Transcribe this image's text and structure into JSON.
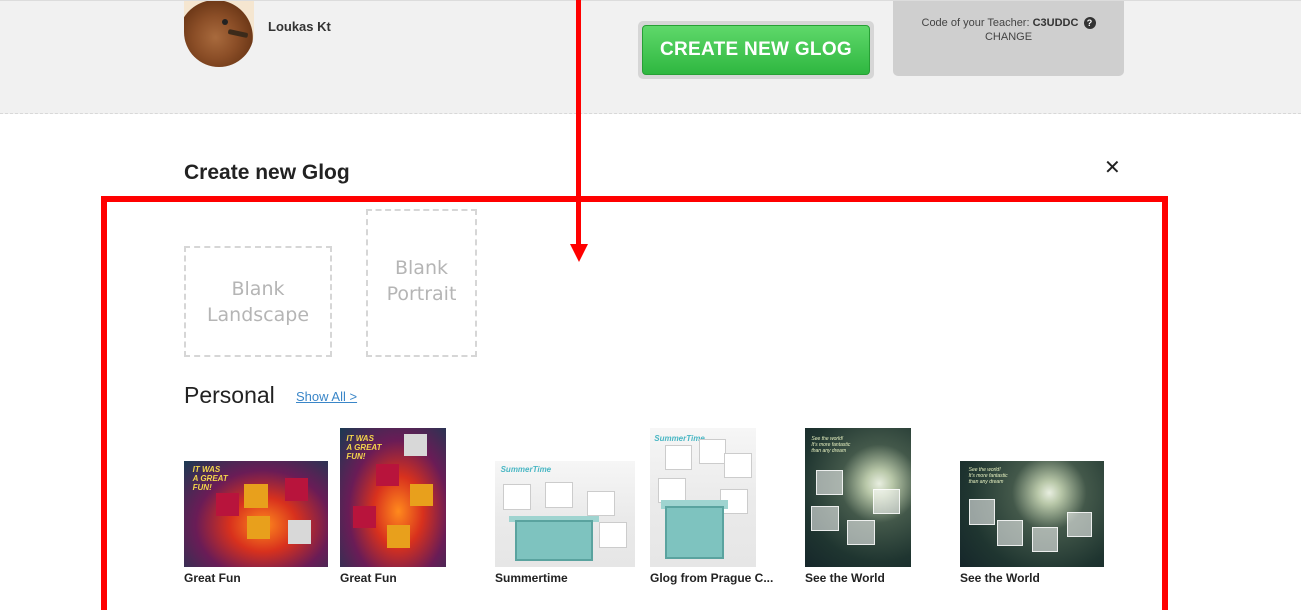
{
  "header": {
    "username": "Loukas Kt",
    "create_button_label": "CREATE NEW GLOG",
    "teacher_code_label": "Code of your Teacher:",
    "teacher_code": "C3UDDC",
    "help_icon_glyph": "?",
    "change_label": "CHANGE"
  },
  "modal": {
    "title": "Create new Glog",
    "close_glyph": "✕",
    "blank_landscape_line1": "Blank",
    "blank_landscape_line2": "Landscape",
    "blank_portrait_line1": "Blank",
    "blank_portrait_line2": "Portrait",
    "section_title": "Personal",
    "show_all_label": "Show All >",
    "templates": [
      {
        "name": "Great Fun"
      },
      {
        "name": "Great Fun"
      },
      {
        "name": "Summertime"
      },
      {
        "name": "Glog from Prague C..."
      },
      {
        "name": "See the World"
      },
      {
        "name": "See the World"
      }
    ]
  },
  "colors": {
    "create_button": "#3cc84a",
    "annotation": "#ff0000",
    "link": "#3a86c8"
  }
}
